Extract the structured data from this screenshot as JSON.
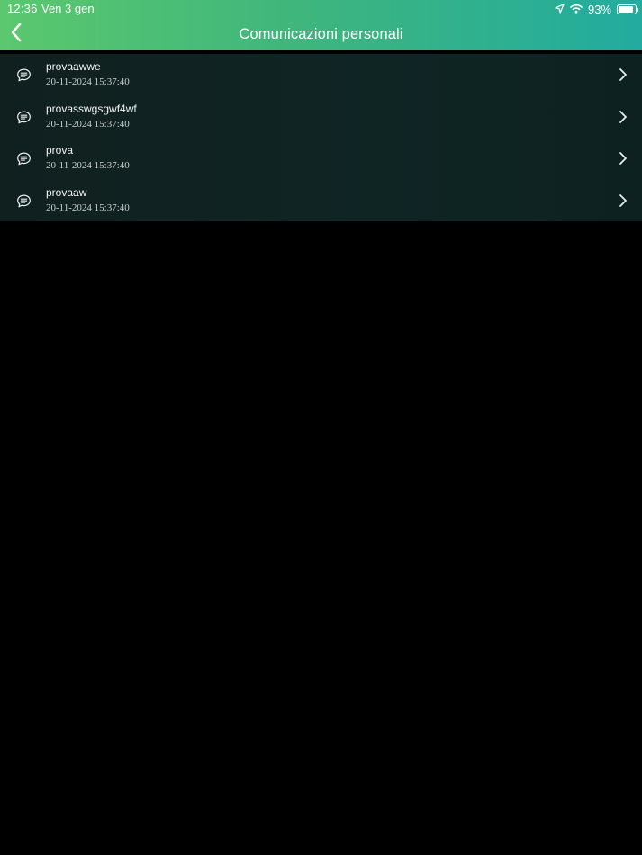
{
  "status_bar": {
    "time": "12:36",
    "date": "Ven 3 gen",
    "battery_percent_text": "93%",
    "battery_level": 0.93,
    "icons": [
      "location-arrow-icon",
      "wifi-icon",
      "battery-icon"
    ]
  },
  "nav": {
    "title": "Comunicazioni personali",
    "back_icon": "chevron-left-icon"
  },
  "messages": [
    {
      "title": "provaawwe",
      "date": "20-11-2024 15:37:40",
      "icon": "message-bubble-icon"
    },
    {
      "title": "provasswgsgwf4wf",
      "date": "20-11-2024 15:37:40",
      "icon": "message-bubble-icon"
    },
    {
      "title": "prova",
      "date": "20-11-2024 15:37:40",
      "icon": "message-bubble-icon"
    },
    {
      "title": "provaaw",
      "date": "20-11-2024 15:37:40",
      "icon": "message-bubble-icon"
    }
  ],
  "colors": {
    "header_gradient_start": "#5bc86e",
    "header_gradient_end": "#22ab9f",
    "list_background": "#0f2321",
    "page_background": "#000000"
  }
}
